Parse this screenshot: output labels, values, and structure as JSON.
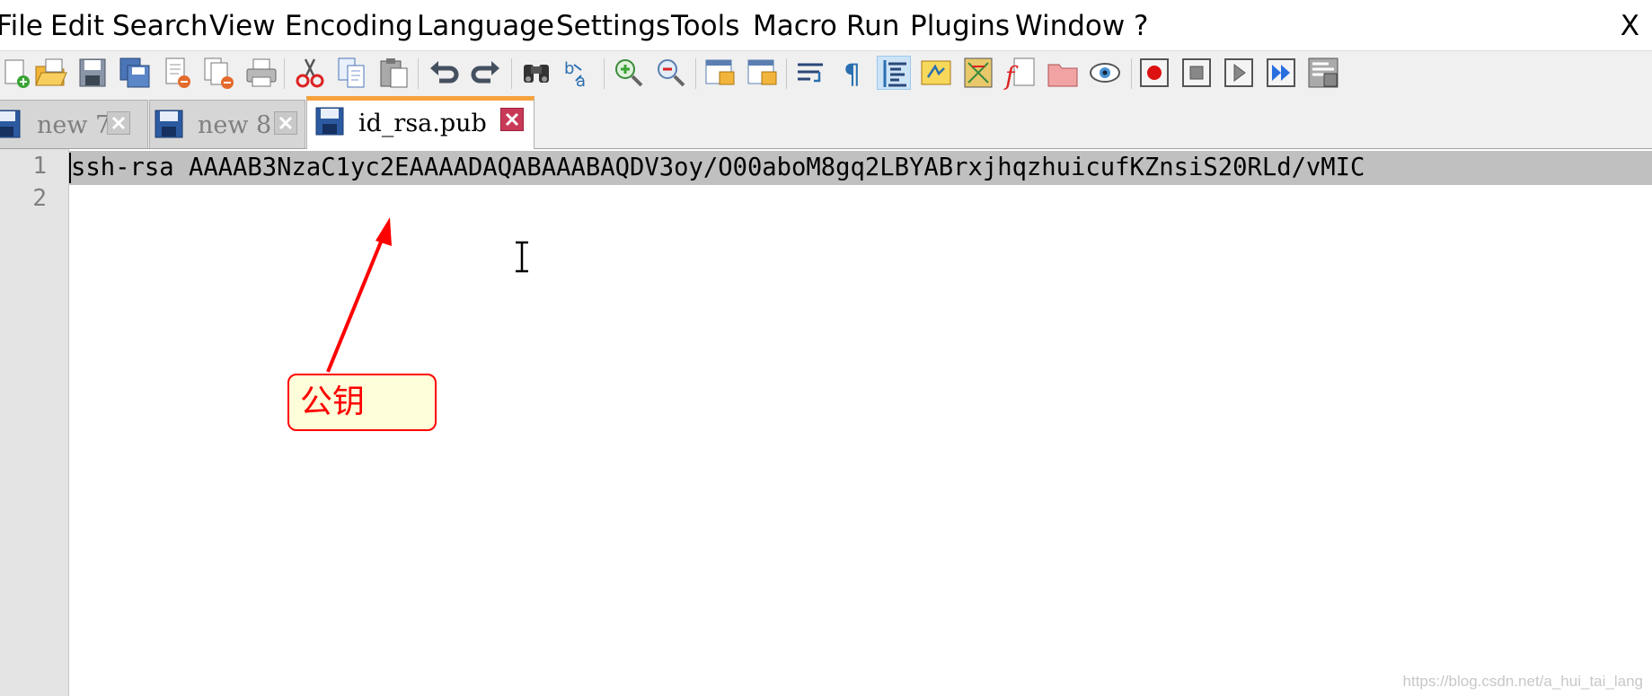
{
  "menu": {
    "items": [
      "File",
      "Edit",
      "Search",
      "View",
      "Encoding",
      "Language",
      "Settings",
      "Tools",
      "Macro",
      "Run",
      "Plugins",
      "Window",
      "?"
    ],
    "close_label": "X"
  },
  "toolbar": {
    "icons": [
      "new-file-icon",
      "open-file-icon",
      "save-icon",
      "save-all-icon",
      "close-icon",
      "close-all-icon",
      "print-icon",
      "cut-icon",
      "copy-icon",
      "paste-icon",
      "undo-icon",
      "redo-icon",
      "find-icon",
      "replace-icon",
      "zoom-in-icon",
      "zoom-out-icon",
      "sync-vertical-icon",
      "sync-horizontal-icon",
      "word-wrap-icon",
      "show-all-chars-icon",
      "indent-guide-icon",
      "user-defined-language-icon",
      "document-map-icon",
      "function-list-icon",
      "folder-as-workspace-icon",
      "monitoring-icon",
      "macro-record-icon",
      "macro-stop-icon",
      "macro-play-icon",
      "macro-run-multiple-icon",
      "macro-save-icon"
    ]
  },
  "tabs": [
    {
      "label": "new 7",
      "active": false
    },
    {
      "label": "new 8",
      "active": false
    },
    {
      "label": "id_rsa.pub",
      "active": true
    }
  ],
  "editor": {
    "line_numbers": [
      "1",
      "2"
    ],
    "line1": "ssh-rsa AAAAB3NzaC1yc2EAAAADAQABAAABAQDV3oy/O00aboM8gq2LBYABrxjhqzhuicufKZnsiS20RLd/vMIC",
    "line2": ""
  },
  "annotation": {
    "text": "公钥",
    "color": "#ff0000"
  },
  "watermark": "https://blog.csdn.net/a_hui_tai_lang",
  "colors": {
    "active_tab_accent": "#f7a33c",
    "line_highlight": "#c0c0c0",
    "gutter": "#e4e4e4"
  }
}
